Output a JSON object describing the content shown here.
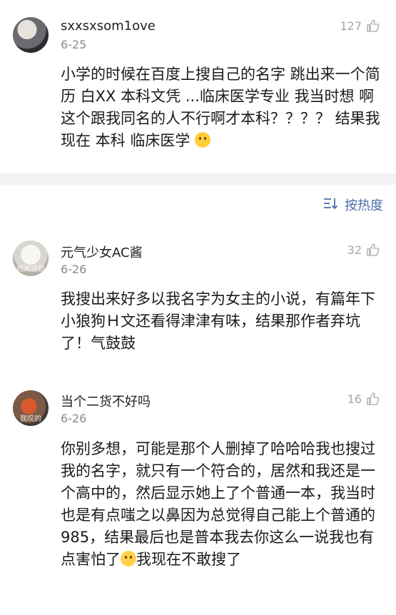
{
  "comments": [
    {
      "username": "sxxsxsom1ove",
      "date": "6-25",
      "likes": "127",
      "text": "小学的时候在百度上搜自己的名字 跳出来一个简历 白XX 本科文凭 ...临床医学专业 我当时想 啊这个跟我同名的人不行啊才本科？？？？ 结果我现在 本科 临床医学 ",
      "emoji": "smile-emoji"
    },
    {
      "username": "元气少女AC酱",
      "date": "6-26",
      "likes": "32",
      "text": "我搜出来好多以我名字为女主的小说，有篇年下小狼狗Ｈ文还看得津津有味，结果那作者弃坑了！气鼓鼓"
    },
    {
      "username": "当个二货不好吗",
      "date": "6-26",
      "likes": "16",
      "text_main": "你别多想，可能是那个人删掉了哈哈哈我也搜过我的名字，就只有一个符合的，居然和我还是一个高中的，然后显示她上了个普通一本，我当时也是有点嗤之以鼻因为总觉得自己能上个普通的985，结果最后也是普本我去你这么一说我也有点害怕了",
      "text_tail": "我现在不敢搜了",
      "emoji": "laughing-tears-emoji"
    }
  ],
  "sort": {
    "label": "按热度",
    "icon": "sort-icon"
  },
  "avatar_captions": [
    "",
    "相关话题",
    "我叹的"
  ],
  "colors": {
    "link_blue": "#4a6eaa",
    "muted": "#8a8a8a",
    "divider": "#f2f2f2"
  }
}
